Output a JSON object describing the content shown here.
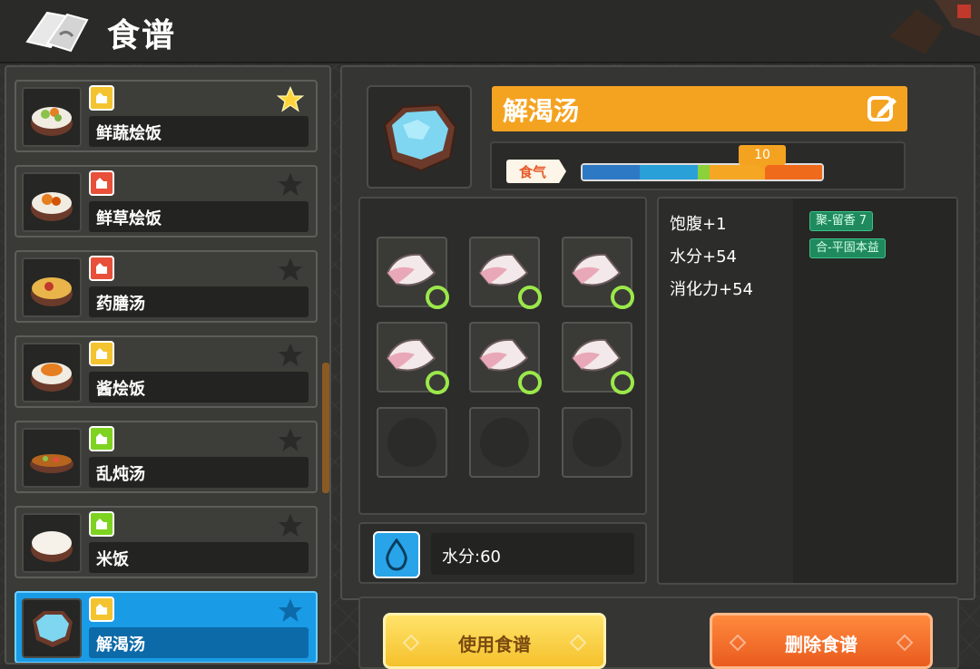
{
  "header": {
    "title": "食谱"
  },
  "recipes": [
    {
      "name": "鲜蔬烩饭",
      "badge_color": "#f4c430",
      "starred": true
    },
    {
      "name": "鲜草烩饭",
      "badge_color": "#e8503a",
      "starred": false
    },
    {
      "name": "药膳汤",
      "badge_color": "#e8503a",
      "starred": false
    },
    {
      "name": "酱烩饭",
      "badge_color": "#f4c430",
      "starred": false
    },
    {
      "name": "乱炖汤",
      "badge_color": "#7ed321",
      "starred": false
    },
    {
      "name": "米饭",
      "badge_color": "#7ed321",
      "starred": false
    },
    {
      "name": "解渴汤",
      "badge_color": "#f4c430",
      "starred": false,
      "selected": true
    }
  ],
  "detail": {
    "title": "解渴汤",
    "qi_label": "食气",
    "qi_value": "10",
    "ingredients_filled": 6,
    "ingredients_total": 9,
    "water_text": "水分:60",
    "effects": [
      "饱腹+1",
      "水分+54",
      "消化力+54"
    ],
    "buffs": [
      "聚-留香 7",
      "合-平固本益"
    ]
  },
  "buttons": {
    "use": "使用食谱",
    "delete": "删除食谱"
  },
  "colors": {
    "accent": "#f4a321",
    "selected": "#1a9be6",
    "use_button": "#f5c12c",
    "delete_button": "#e95b1e"
  }
}
